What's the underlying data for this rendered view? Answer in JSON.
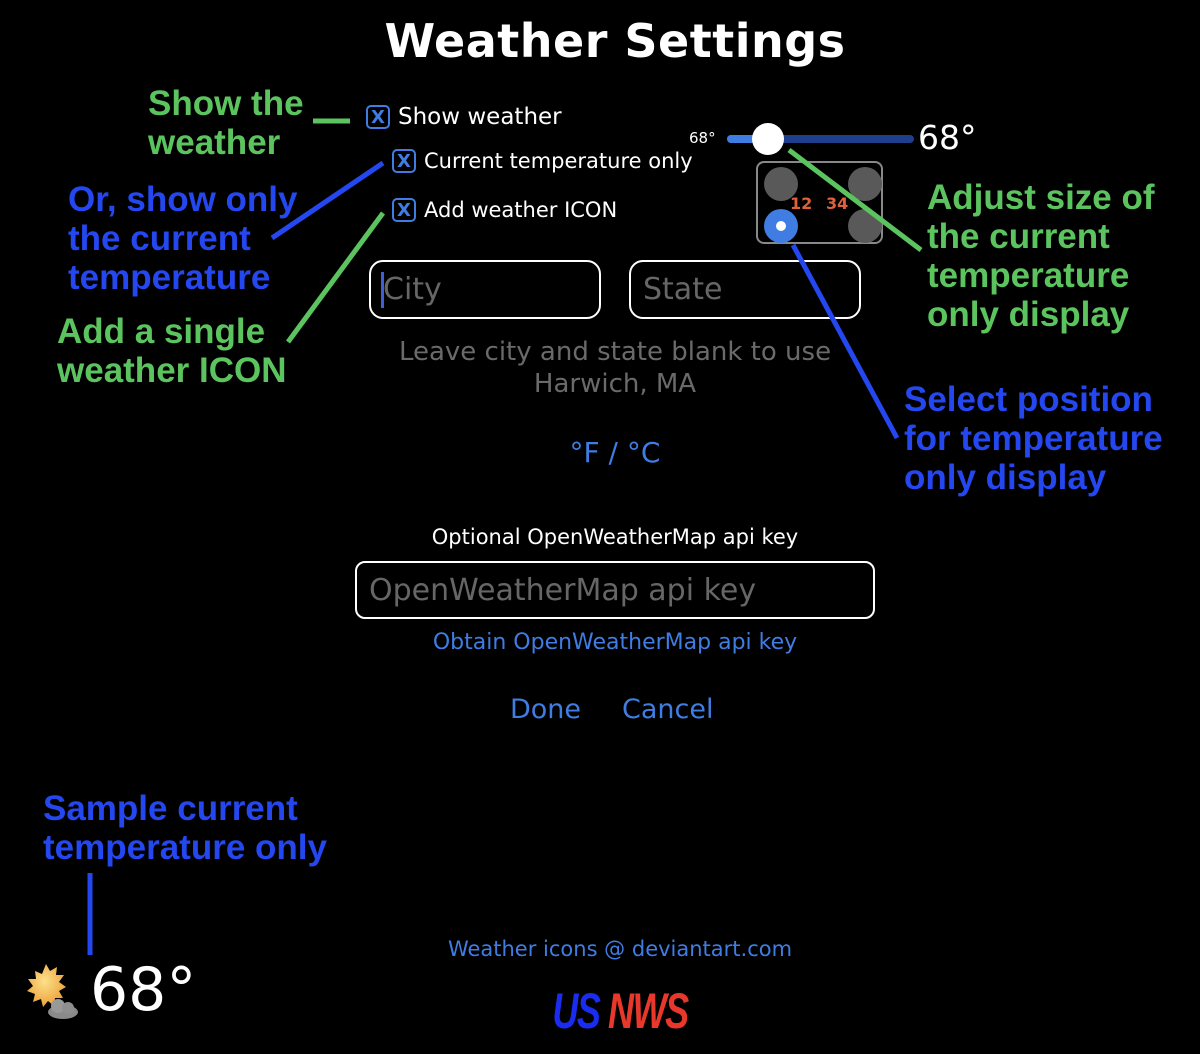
{
  "title": "Weather Settings",
  "checkboxes": {
    "show_weather": {
      "label": "Show weather",
      "checked": true,
      "mark": "X"
    },
    "current_temp_only": {
      "label": "Current temperature only",
      "checked": true,
      "mark": "X"
    },
    "add_icon": {
      "label": "Add weather ICON",
      "checked": true,
      "mark": "X"
    }
  },
  "size_slider": {
    "min_label": "68°",
    "value_label": "68°",
    "fraction": 0.22
  },
  "position_picker": {
    "labels": [
      "12",
      "34"
    ],
    "selected": "bottom-left"
  },
  "location": {
    "city_placeholder": "City",
    "city_value": "",
    "state_placeholder": "State",
    "state_value": "",
    "hint_line1": "Leave city and state blank to use",
    "hint_line2": "Harwich, MA"
  },
  "units_toggle": "°F / °C",
  "api_key": {
    "label": "Optional OpenWeatherMap api key",
    "placeholder": "OpenWeatherMap api key",
    "value": "",
    "obtain_link": "Obtain OpenWeatherMap api key"
  },
  "actions": {
    "done": "Done",
    "cancel": "Cancel"
  },
  "credits": "Weather icons @  deviantart.com",
  "logo": {
    "part1": "US",
    "part2": "NWS",
    "color1": "#1a2cf0",
    "color2": "#e8382b"
  },
  "sample": {
    "temperature": "68°",
    "icon": "partly-sunny-icon"
  },
  "annotations": {
    "show_weather": [
      "Show the",
      "weather"
    ],
    "current_only": [
      "Or, show only",
      "the current",
      "temperature"
    ],
    "single_icon": [
      "Add a single",
      "weather ICON"
    ],
    "adjust_size": [
      "Adjust size of",
      "the current",
      "temperature",
      "only display"
    ],
    "select_position": [
      "Select position",
      "for temperature",
      "only display"
    ],
    "sample": [
      "Sample current",
      "temperature only"
    ]
  },
  "colors": {
    "accent": "#3f7de3",
    "annotation_green": "#5cc45e",
    "annotation_blue": "#2447f0",
    "position_numbers": "#e0603a"
  }
}
